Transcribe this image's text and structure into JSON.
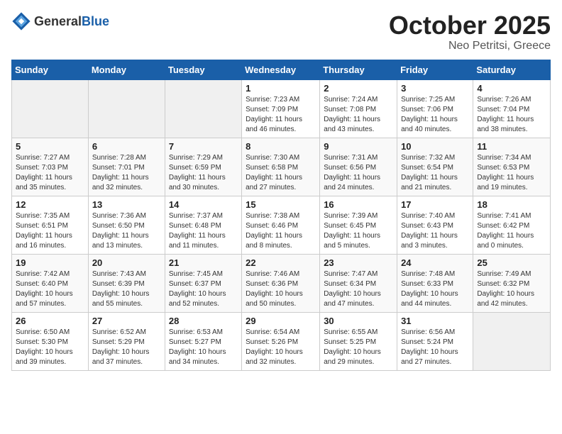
{
  "header": {
    "logo_general": "General",
    "logo_blue": "Blue",
    "title": "October 2025",
    "subtitle": "Neo Petritsi, Greece"
  },
  "days_of_week": [
    "Sunday",
    "Monday",
    "Tuesday",
    "Wednesday",
    "Thursday",
    "Friday",
    "Saturday"
  ],
  "weeks": [
    [
      {
        "day": "",
        "info": ""
      },
      {
        "day": "",
        "info": ""
      },
      {
        "day": "",
        "info": ""
      },
      {
        "day": "1",
        "info": "Sunrise: 7:23 AM\nSunset: 7:09 PM\nDaylight: 11 hours and 46 minutes."
      },
      {
        "day": "2",
        "info": "Sunrise: 7:24 AM\nSunset: 7:08 PM\nDaylight: 11 hours and 43 minutes."
      },
      {
        "day": "3",
        "info": "Sunrise: 7:25 AM\nSunset: 7:06 PM\nDaylight: 11 hours and 40 minutes."
      },
      {
        "day": "4",
        "info": "Sunrise: 7:26 AM\nSunset: 7:04 PM\nDaylight: 11 hours and 38 minutes."
      }
    ],
    [
      {
        "day": "5",
        "info": "Sunrise: 7:27 AM\nSunset: 7:03 PM\nDaylight: 11 hours and 35 minutes."
      },
      {
        "day": "6",
        "info": "Sunrise: 7:28 AM\nSunset: 7:01 PM\nDaylight: 11 hours and 32 minutes."
      },
      {
        "day": "7",
        "info": "Sunrise: 7:29 AM\nSunset: 6:59 PM\nDaylight: 11 hours and 30 minutes."
      },
      {
        "day": "8",
        "info": "Sunrise: 7:30 AM\nSunset: 6:58 PM\nDaylight: 11 hours and 27 minutes."
      },
      {
        "day": "9",
        "info": "Sunrise: 7:31 AM\nSunset: 6:56 PM\nDaylight: 11 hours and 24 minutes."
      },
      {
        "day": "10",
        "info": "Sunrise: 7:32 AM\nSunset: 6:54 PM\nDaylight: 11 hours and 21 minutes."
      },
      {
        "day": "11",
        "info": "Sunrise: 7:34 AM\nSunset: 6:53 PM\nDaylight: 11 hours and 19 minutes."
      }
    ],
    [
      {
        "day": "12",
        "info": "Sunrise: 7:35 AM\nSunset: 6:51 PM\nDaylight: 11 hours and 16 minutes."
      },
      {
        "day": "13",
        "info": "Sunrise: 7:36 AM\nSunset: 6:50 PM\nDaylight: 11 hours and 13 minutes."
      },
      {
        "day": "14",
        "info": "Sunrise: 7:37 AM\nSunset: 6:48 PM\nDaylight: 11 hours and 11 minutes."
      },
      {
        "day": "15",
        "info": "Sunrise: 7:38 AM\nSunset: 6:46 PM\nDaylight: 11 hours and 8 minutes."
      },
      {
        "day": "16",
        "info": "Sunrise: 7:39 AM\nSunset: 6:45 PM\nDaylight: 11 hours and 5 minutes."
      },
      {
        "day": "17",
        "info": "Sunrise: 7:40 AM\nSunset: 6:43 PM\nDaylight: 11 hours and 3 minutes."
      },
      {
        "day": "18",
        "info": "Sunrise: 7:41 AM\nSunset: 6:42 PM\nDaylight: 11 hours and 0 minutes."
      }
    ],
    [
      {
        "day": "19",
        "info": "Sunrise: 7:42 AM\nSunset: 6:40 PM\nDaylight: 10 hours and 57 minutes."
      },
      {
        "day": "20",
        "info": "Sunrise: 7:43 AM\nSunset: 6:39 PM\nDaylight: 10 hours and 55 minutes."
      },
      {
        "day": "21",
        "info": "Sunrise: 7:45 AM\nSunset: 6:37 PM\nDaylight: 10 hours and 52 minutes."
      },
      {
        "day": "22",
        "info": "Sunrise: 7:46 AM\nSunset: 6:36 PM\nDaylight: 10 hours and 50 minutes."
      },
      {
        "day": "23",
        "info": "Sunrise: 7:47 AM\nSunset: 6:34 PM\nDaylight: 10 hours and 47 minutes."
      },
      {
        "day": "24",
        "info": "Sunrise: 7:48 AM\nSunset: 6:33 PM\nDaylight: 10 hours and 44 minutes."
      },
      {
        "day": "25",
        "info": "Sunrise: 7:49 AM\nSunset: 6:32 PM\nDaylight: 10 hours and 42 minutes."
      }
    ],
    [
      {
        "day": "26",
        "info": "Sunrise: 6:50 AM\nSunset: 5:30 PM\nDaylight: 10 hours and 39 minutes."
      },
      {
        "day": "27",
        "info": "Sunrise: 6:52 AM\nSunset: 5:29 PM\nDaylight: 10 hours and 37 minutes."
      },
      {
        "day": "28",
        "info": "Sunrise: 6:53 AM\nSunset: 5:27 PM\nDaylight: 10 hours and 34 minutes."
      },
      {
        "day": "29",
        "info": "Sunrise: 6:54 AM\nSunset: 5:26 PM\nDaylight: 10 hours and 32 minutes."
      },
      {
        "day": "30",
        "info": "Sunrise: 6:55 AM\nSunset: 5:25 PM\nDaylight: 10 hours and 29 minutes."
      },
      {
        "day": "31",
        "info": "Sunrise: 6:56 AM\nSunset: 5:24 PM\nDaylight: 10 hours and 27 minutes."
      },
      {
        "day": "",
        "info": ""
      }
    ]
  ]
}
